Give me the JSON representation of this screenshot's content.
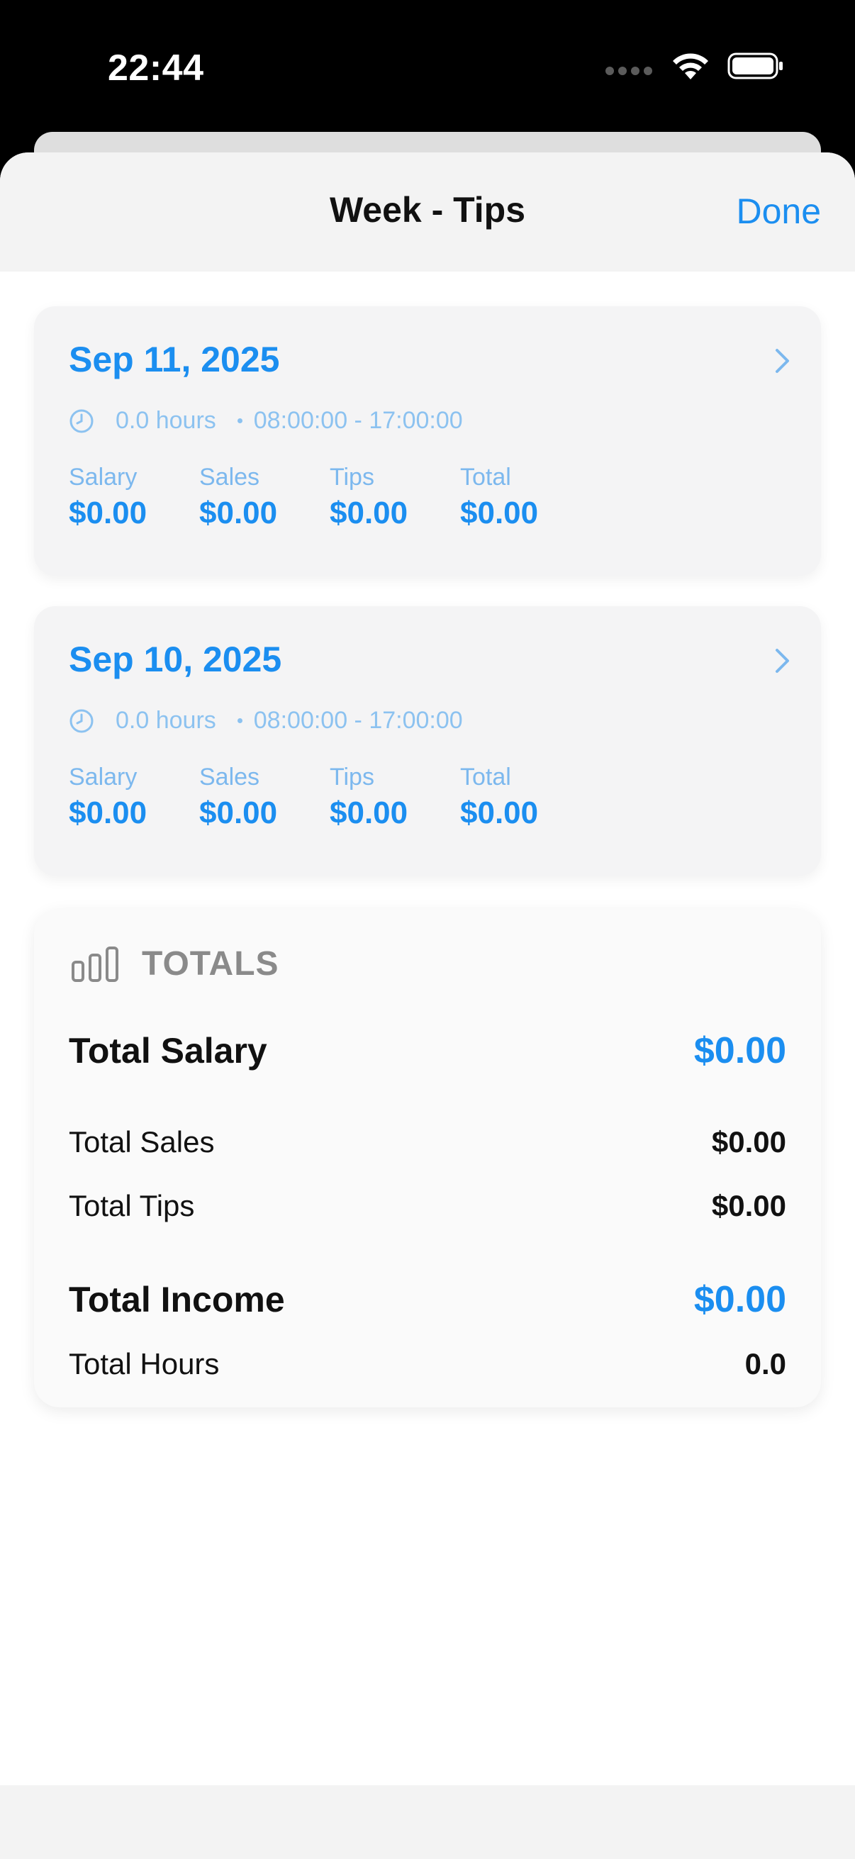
{
  "status": {
    "time": "22:44"
  },
  "nav": {
    "title": "Week - Tips",
    "done_label": "Done"
  },
  "colors": {
    "accent": "#1b8ef0",
    "accent_light": "#8cc2f0",
    "muted": "#8a8a8a"
  },
  "days": [
    {
      "date": "Sep 11, 2025",
      "hours": "0.0 hours",
      "time_range": "08:00:00 - 17:00:00",
      "columns": [
        {
          "label": "Salary",
          "value": "$0.00"
        },
        {
          "label": "Sales",
          "value": "$0.00"
        },
        {
          "label": "Tips",
          "value": "$0.00"
        },
        {
          "label": "Total",
          "value": "$0.00"
        }
      ]
    },
    {
      "date": "Sep 10, 2025",
      "hours": "0.0 hours",
      "time_range": "08:00:00 - 17:00:00",
      "columns": [
        {
          "label": "Salary",
          "value": "$0.00"
        },
        {
          "label": "Sales",
          "value": "$0.00"
        },
        {
          "label": "Tips",
          "value": "$0.00"
        },
        {
          "label": "Total",
          "value": "$0.00"
        }
      ]
    }
  ],
  "totals": {
    "title": "TOTALS",
    "rows": [
      {
        "label": "Total Salary",
        "value": "$0.00"
      },
      {
        "label": "Total Sales",
        "value": "$0.00"
      },
      {
        "label": "Total Tips",
        "value": "$0.00"
      },
      {
        "label": "Total Income",
        "value": "$0.00"
      },
      {
        "label": "Total Hours",
        "value": "0.0"
      }
    ]
  },
  "icons": {
    "clock": "clock-icon",
    "chevron": "chevron-right-icon",
    "totals": "bar-chart-icon",
    "wifi": "wifi-icon",
    "battery": "battery-icon"
  }
}
